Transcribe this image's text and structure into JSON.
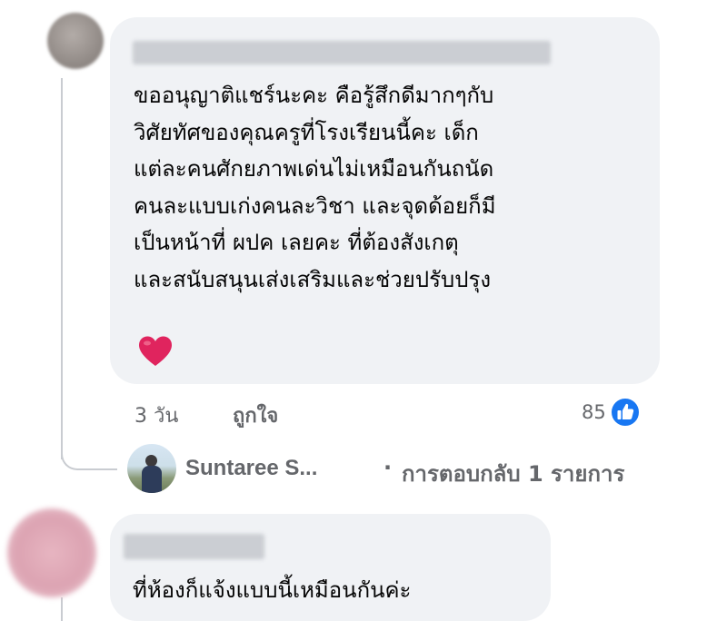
{
  "comments": [
    {
      "text_lines": [
        "ขออนุญาติแชร์นะคะ คือรู้สึกดีมากๆกับ",
        "วิศัยทัศของคุณครูที่โรงเรียนนี้คะ เด็ก",
        "แต่ละคนศักยภาพเด่นไม่เหมือนกันถนัด",
        "คนละแบบเก่งคนละวิชา และจุดด้อยก็มี",
        "เป็นหน้าที่ ผปค เลยคะ ที่ต้องสังเกตุ",
        "และสนับสนุนเส่งเสริมและช่วยปรับปรุง"
      ],
      "emoji": "heart",
      "time": "3 วัน",
      "like_label": "ถูกใจ",
      "reaction_count": "85",
      "reaction_icon": "thumbs-up-icon",
      "reply_preview": {
        "author": "Suntaree S...",
        "separator": "·",
        "summary": "การตอบกลับ 1 รายการ"
      }
    },
    {
      "text_lines": [
        "ที่ห้องก็แจ้งแบบนี้เหมือนกันค่ะ"
      ]
    }
  ],
  "colors": {
    "bubble": "#f0f2f5",
    "secondary_text": "#65676b",
    "like_blue": "#1877f2",
    "heart_red": "#e0245e"
  }
}
